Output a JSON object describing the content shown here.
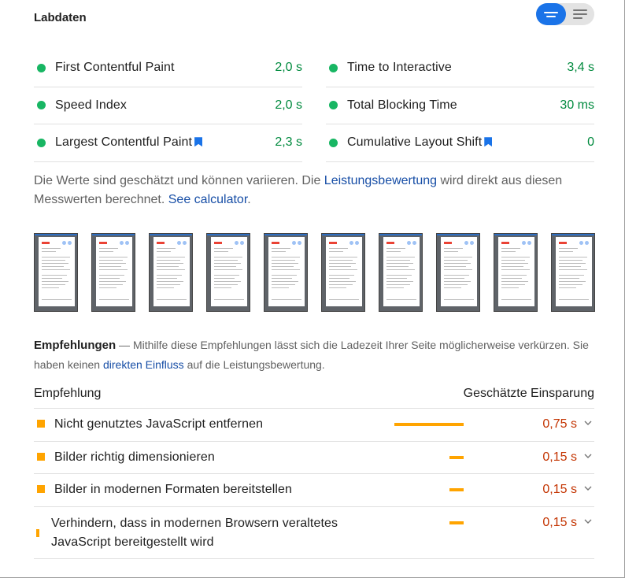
{
  "section_title": "Labdaten",
  "view_toggle": {
    "active": "list-view",
    "options": [
      "list-view",
      "text-view"
    ]
  },
  "metrics": {
    "left": [
      {
        "label": "First Contentful Paint",
        "value": "2,0 s",
        "status": "good",
        "bookmark": false
      },
      {
        "label": "Speed Index",
        "value": "2,0 s",
        "status": "good",
        "bookmark": false
      },
      {
        "label": "Largest Contentful Paint",
        "value": "2,3 s",
        "status": "good",
        "bookmark": true
      }
    ],
    "right": [
      {
        "label": "Time to Interactive",
        "value": "3,4 s",
        "status": "good",
        "bookmark": false
      },
      {
        "label": "Total Blocking Time",
        "value": "30 ms",
        "status": "good",
        "bookmark": false
      },
      {
        "label": "Cumulative Layout Shift",
        "value": "0",
        "status": "good",
        "bookmark": true
      }
    ]
  },
  "note": {
    "text_1": "Die Werte sind geschätzt und können variieren. Die ",
    "link_1": "Leistungsbewertung",
    "text_2": " wird direkt aus diesen Messwerten berechnet. ",
    "link_2": "See calculator",
    "text_3": "."
  },
  "filmstrip_count": 10,
  "recommendations": {
    "title": "Empfehlungen",
    "desc_1": " — Mithilfe diese Empfehlungen lässt sich die Ladezeit Ihrer Seite möglicherweise verkürzen. Sie haben keinen ",
    "desc_link": "direkten Einfluss",
    "desc_2": " auf die Leistungsbewertung.",
    "col_recommendation": "Empfehlung",
    "col_savings": "Geschätzte Einsparung",
    "items": [
      {
        "label": "Nicht genutztes JavaScript entfernen",
        "value": "0,75 s",
        "savings_fraction": 1.0
      },
      {
        "label": "Bilder richtig dimensionieren",
        "value": "0,15 s",
        "savings_fraction": 0.2
      },
      {
        "label": "Bilder in modernen Formaten bereitstellen",
        "value": "0,15 s",
        "savings_fraction": 0.2
      },
      {
        "label": "Verhindern, dass in modernen Browsern veraltetes JavaScript bereitgestellt wird",
        "value": "0,15 s",
        "savings_fraction": 0.2
      }
    ]
  },
  "colors": {
    "good": "#18b663",
    "average": "#ffa400",
    "accent": "#1a73e8",
    "link": "#174ea6",
    "savings_text": "#c33300"
  }
}
